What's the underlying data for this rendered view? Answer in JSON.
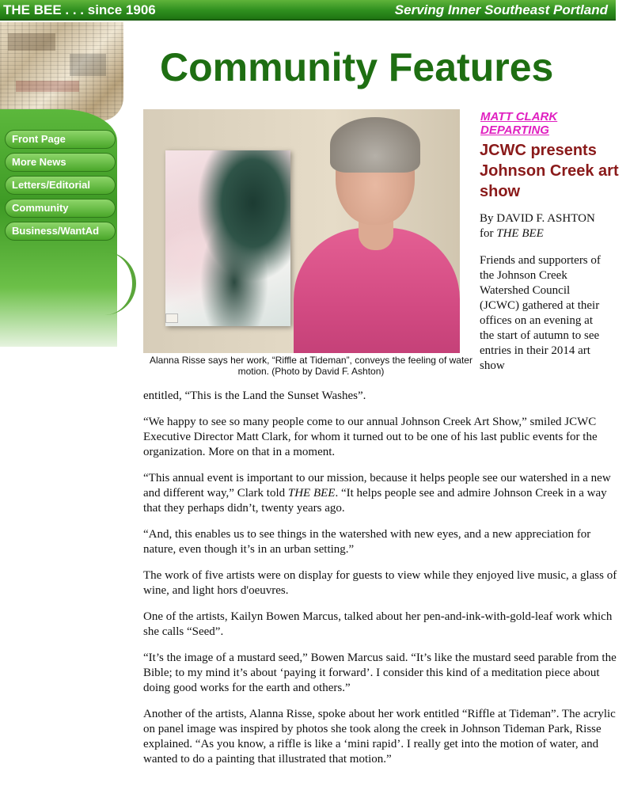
{
  "topbar": {
    "brand": "THE BEE . . . since 1906",
    "tagline": "Serving Inner Southeast Portland"
  },
  "nav": [
    {
      "label": "Front Page"
    },
    {
      "label": "More News"
    },
    {
      "label": "Letters/Editorial"
    },
    {
      "label": "Community"
    },
    {
      "label": "Business/WantAd"
    }
  ],
  "page_title": "Community Features",
  "photo": {
    "caption": "Alanna Risse says her work, “Riffle at Tideman”, conveys the feeling of water motion. (Photo by David F. Ashton)"
  },
  "article": {
    "kicker": "MATT CLARK DEPARTING",
    "headline": "JCWC presents Johnson Creek art show",
    "byline_prefix": "By DAVID F. ASHTON",
    "byline_for": "for ",
    "byline_pub": "THE BEE",
    "intro": "Friends and supporters of the Johnson Creek Watershed Council (JCWC) gathered at their offices on an evening at the start of autumn to see entries in their 2014 art show",
    "continuation": "entitled, “This is the Land the Sunset Washes”.",
    "p1": "“We happy to see so many people come to our annual Johnson Creek Art Show,” smiled JCWC Executive Director Matt Clark, for whom it turned out to be one of his last public events for the organization. More on that in a moment.",
    "p2a": "“This annual event is important to our mission, because it helps people see our watershed in a new and different way,” Clark told ",
    "p2_pub": "THE BEE",
    "p2b": ". “It helps people see and admire Johnson Creek in a way that they perhaps didn’t, twenty years ago.",
    "p3": "“And, this enables us to see things in the watershed with new eyes, and a new appreciation for nature, even though it’s in an urban setting.”",
    "p4": "The work of five artists were on display for guests to view while they enjoyed live music, a glass of wine, and light hors d'oeuvres.",
    "p5": "One of the artists, Kailyn Bowen Marcus, talked about her pen-and-ink-with-gold-leaf work which she calls “Seed”.",
    "p6": "“It’s the image of a mustard seed,” Bowen Marcus said. “It’s like the mustard seed parable from the Bible; to my mind it’s about ‘paying it forward’. I consider this kind of a meditation piece about doing good works for the earth and others.”",
    "p7": "Another of the artists, Alanna Risse, spoke about her work entitled “Riffle at Tideman”. The acrylic on panel image was inspired by photos she took along the creek in Johnson Tideman Park, Risse explained. “As you know, a riffle is like a ‘mini rapid’. I really get into the motion of water, and wanted to do a painting that illustrated that motion.”"
  }
}
